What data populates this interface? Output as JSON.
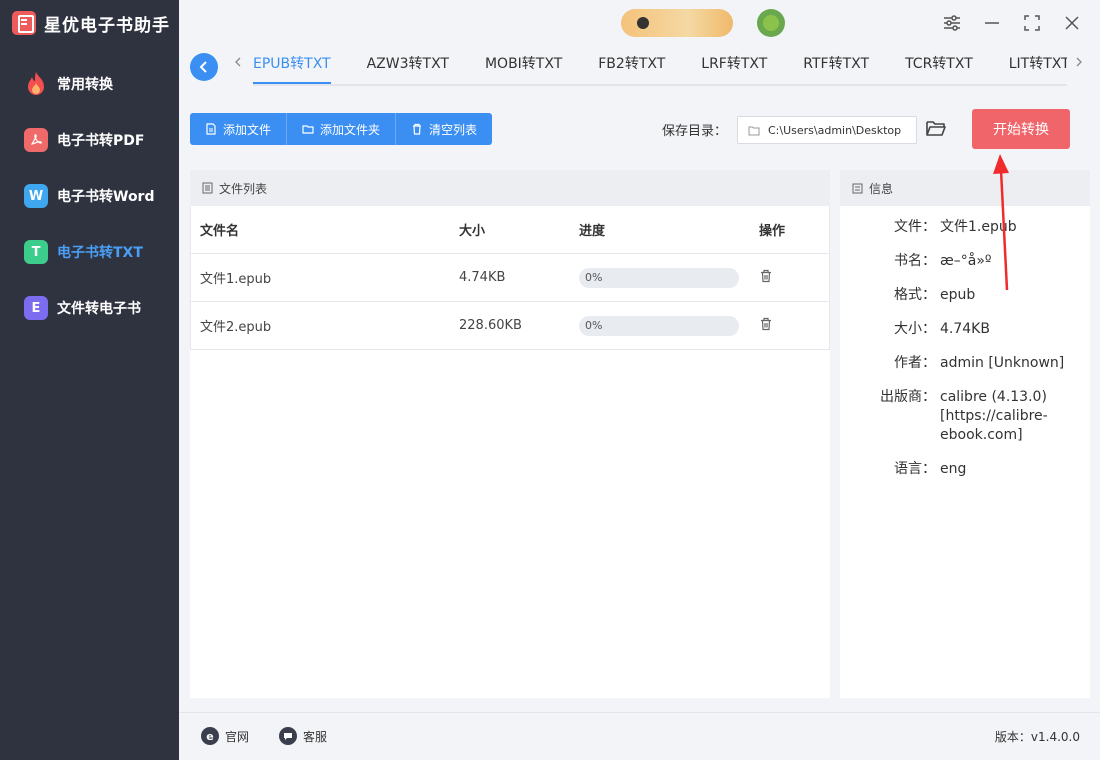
{
  "app": {
    "title": "星优电子书助手"
  },
  "sidebar": {
    "items": [
      {
        "label": "常用转换",
        "icon": "fire-icon",
        "active": false
      },
      {
        "label": "电子书转PDF",
        "icon": "pdf-icon",
        "active": false
      },
      {
        "label": "电子书转Word",
        "icon": "word-icon",
        "glyph": "W",
        "active": false
      },
      {
        "label": "电子书转TXT",
        "icon": "txt-icon",
        "glyph": "T",
        "active": true
      },
      {
        "label": "文件转电子书",
        "icon": "ebook-icon",
        "glyph": "E",
        "active": false
      }
    ]
  },
  "tabs": [
    "EPUB转TXT",
    "AZW3转TXT",
    "MOBI转TXT",
    "FB2转TXT",
    "LRF转TXT",
    "RTF转TXT",
    "TCR转TXT",
    "LIT转TXT"
  ],
  "active_tab": 0,
  "toolbar": {
    "add_file": "添加文件",
    "add_folder": "添加文件夹",
    "clear_list": "清空列表"
  },
  "save": {
    "label": "保存目录：",
    "path": "C:\\Users\\admin\\Desktop"
  },
  "start_button": "开始转换",
  "file_list": {
    "title": "文件列表",
    "columns": [
      "文件名",
      "大小",
      "进度",
      "操作"
    ],
    "rows": [
      {
        "name": "文件1.epub",
        "size": "4.74KB",
        "progress": 0,
        "progress_text": "0%"
      },
      {
        "name": "文件2.epub",
        "size": "228.60KB",
        "progress": 0,
        "progress_text": "0%"
      }
    ]
  },
  "info": {
    "title": "信息",
    "rows": [
      {
        "key": "文件：",
        "value": "文件1.epub"
      },
      {
        "key": "书名：",
        "value": "æ–°å»º"
      },
      {
        "key": "格式：",
        "value": "epub"
      },
      {
        "key": "大小：",
        "value": "4.74KB"
      },
      {
        "key": "作者：",
        "value": "admin [Unknown]"
      },
      {
        "key": "出版商：",
        "value": "calibre (4.13.0) [https://calibre-ebook.com]"
      },
      {
        "key": "语言：",
        "value": "eng"
      }
    ]
  },
  "footer": {
    "website": "官网",
    "support": "客服",
    "version": "版本：v1.4.0.0"
  },
  "colors": {
    "accent": "#3b8ff3",
    "start": "#f0656a",
    "sidebar": "#2f3340",
    "active_nav": "#4a9ef5"
  }
}
